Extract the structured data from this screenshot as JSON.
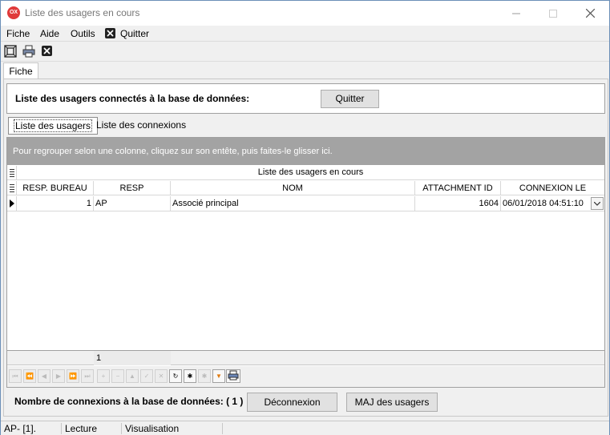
{
  "window": {
    "title": "Liste des usagers en cours",
    "icon_text": "OX"
  },
  "menu": {
    "fiche": "Fiche",
    "aide": "Aide",
    "outils": "Outils",
    "quitter": "Quitter"
  },
  "tabs": {
    "fiche": "Fiche"
  },
  "header": {
    "label": "Liste des usagers connectés à la base de données:",
    "quit_button": "Quitter"
  },
  "subtabs": {
    "usagers": "Liste des usagers",
    "connexions": "Liste des connexions"
  },
  "grid": {
    "group_hint": "Pour regrouper selon une colonne, cliquez sur son entête, puis faites-le glisser ici.",
    "title": "Liste des usagers en cours",
    "columns": [
      "RESP. BUREAU",
      "RESP",
      "NOM",
      "ATTACHMENT ID",
      "CONNEXION LE"
    ],
    "rows": [
      {
        "resp_bureau": "1",
        "resp": "AP",
        "nom": "Associé principal",
        "attachment_id": "1604",
        "connexion_le": "06/01/2018 04:51:10"
      }
    ],
    "footer_count": "1"
  },
  "bottom": {
    "label": "Nombre de connexions à la base de données: ( 1 )",
    "disconnect_button": "Déconnexion",
    "refresh_button": "MAJ des usagers"
  },
  "status": {
    "user": "AP- [1].",
    "mode": "Lecture",
    "view": "Visualisation"
  },
  "colors": {
    "group_panel": "#a3a3a3",
    "app_icon": "#e03a3a",
    "filter_icon": "#e07a10"
  }
}
